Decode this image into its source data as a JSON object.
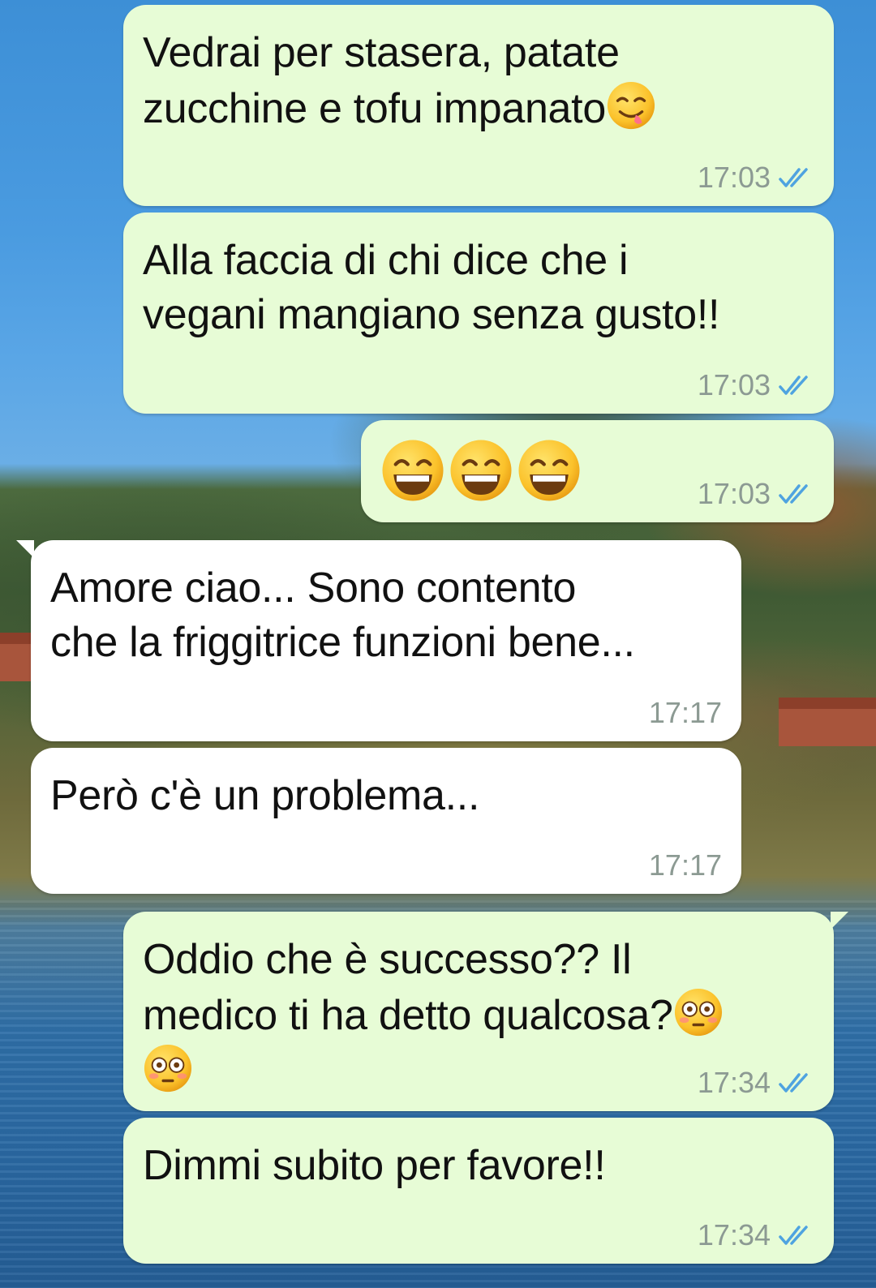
{
  "chat": {
    "messages": [
      {
        "direction": "outgoing",
        "text": "Vedrai per stasera, patate\nzucchine e tofu impanato",
        "trailing_emoji": "savoring-food-emoji",
        "time": "17:03",
        "status": "read"
      },
      {
        "direction": "outgoing",
        "text": "Alla faccia di chi dice che i\nvegani mangiano senza gusto!!",
        "time": "17:03",
        "status": "read"
      },
      {
        "direction": "outgoing",
        "text": "",
        "emojis": [
          "grinning-face-emoji",
          "grinning-face-emoji",
          "grinning-face-emoji"
        ],
        "time": "17:03",
        "status": "read"
      },
      {
        "direction": "incoming",
        "text": "Amore ciao... Sono contento\nche la friggitrice funzioni bene...",
        "time": "17:17"
      },
      {
        "direction": "incoming",
        "text": "Però c'è un problema...",
        "time": "17:17"
      },
      {
        "direction": "outgoing",
        "text": "Oddio che è successo?? Il\nmedico ti ha detto qualcosa?",
        "trailing_emoji": "flushed-face-emoji",
        "extra_line_emoji": "flushed-face-emoji",
        "time": "17:34",
        "status": "read"
      },
      {
        "direction": "outgoing",
        "text": "Dimmi subito per favore!!",
        "time": "17:34",
        "status": "read"
      }
    ]
  },
  "colors": {
    "outgoing_bubble": "#e7fcd6",
    "incoming_bubble": "#ffffff",
    "read_ticks": "#4fa3e0",
    "timestamp": "#8c9a93"
  }
}
